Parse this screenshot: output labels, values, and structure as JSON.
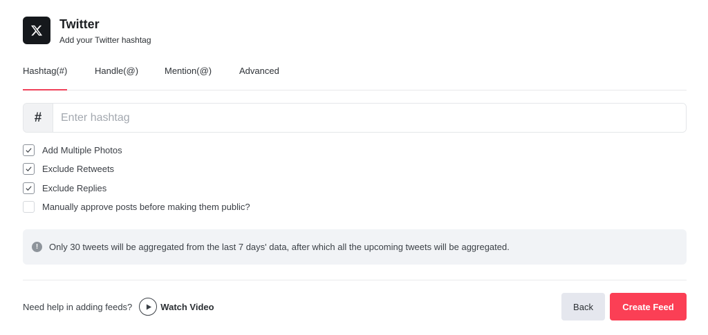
{
  "header": {
    "title": "Twitter",
    "subtitle": "Add your Twitter hashtag",
    "logo_icon": "x-logo-icon"
  },
  "tabs": [
    {
      "label": "Hashtag(#)",
      "active": true
    },
    {
      "label": "Handle(@)",
      "active": false
    },
    {
      "label": "Mention(@)",
      "active": false
    },
    {
      "label": "Advanced",
      "active": false
    }
  ],
  "hashtag_input": {
    "prefix": "#",
    "value": "",
    "placeholder": "Enter hashtag"
  },
  "options": [
    {
      "label": "Add Multiple Photos",
      "checked": true
    },
    {
      "label": "Exclude Retweets",
      "checked": true
    },
    {
      "label": "Exclude Replies",
      "checked": true
    },
    {
      "label": "Manually approve posts before making them public?",
      "checked": false
    }
  ],
  "notice": {
    "icon": "info-icon",
    "text": "Only 30 tweets will be aggregated from the last 7 days' data, after which all the upcoming tweets will be aggregated."
  },
  "footer": {
    "help_text": "Need help in adding feeds?",
    "watch_video_label": "Watch Video",
    "back_label": "Back",
    "create_label": "Create Feed"
  },
  "colors": {
    "accent": "#fb3f55",
    "back_button_bg": "#e5e7ee",
    "notice_bg": "#f1f3f6"
  }
}
